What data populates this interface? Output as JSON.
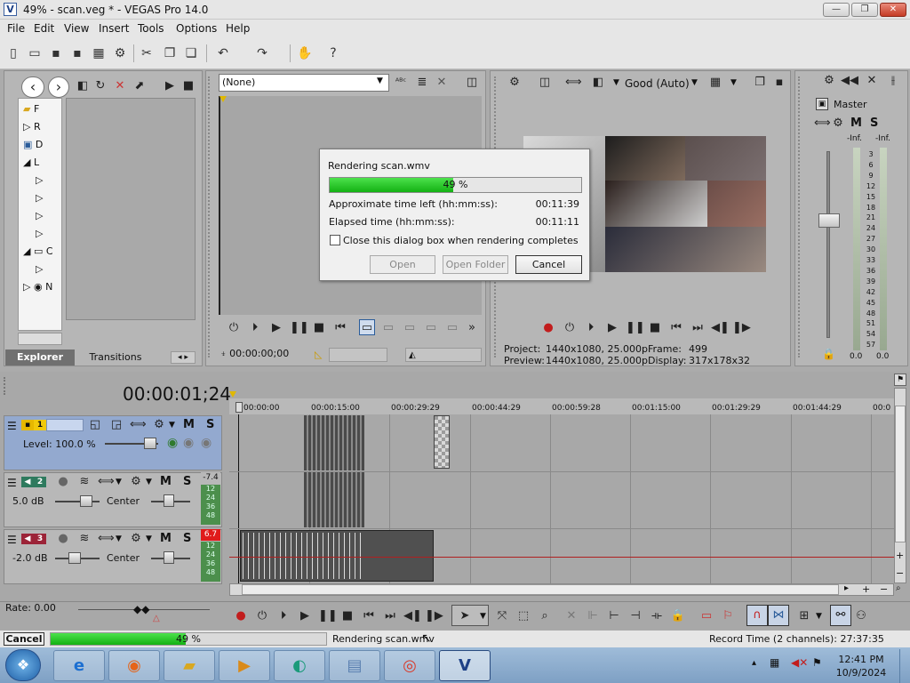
{
  "window": {
    "title": "49% - scan.veg * - VEGAS Pro 14.0",
    "app_icon": "V",
    "minimize": "—",
    "maximize": "❐",
    "close": "✕"
  },
  "menu": [
    "File",
    "Edit",
    "View",
    "Insert",
    "Tools",
    "Options",
    "Help"
  ],
  "explorer": {
    "tree": [
      "F",
      "R",
      "D",
      "L",
      "",
      "",
      "",
      "",
      "C",
      "",
      "N"
    ],
    "tabs": {
      "explorer": "Explorer",
      "transitions": "Transitions"
    }
  },
  "trimmer": {
    "select_value": "(None)",
    "timecode": "00:00:00;00"
  },
  "preview": {
    "quality": "Good (Auto)",
    "project_label": "Project:",
    "project_value": "1440x1080, 25.000p",
    "preview_label": "Preview:",
    "preview_value": "1440x1080, 25.000p",
    "frame_label": "Frame:",
    "frame_value": "499",
    "display_label": "Display:",
    "display_value": "317x178x32"
  },
  "mixer": {
    "master_label": "Master",
    "m": "M",
    "s": "S",
    "left_db": "-Inf.",
    "right_db": "-Inf.",
    "scale": [
      "3",
      "6",
      "9",
      "12",
      "15",
      "18",
      "21",
      "24",
      "27",
      "30",
      "33",
      "36",
      "39",
      "42",
      "45",
      "48",
      "51",
      "54",
      "57"
    ],
    "bottom_left": "0.0",
    "bottom_right": "0.0"
  },
  "dialog": {
    "title": "Rendering scan.wmv",
    "progress": 49,
    "progress_label": "49 %",
    "time_left_label": "Approximate time left (hh:mm:ss):",
    "time_left_value": "00:11:39",
    "elapsed_label": "Elapsed time (hh:mm:ss):",
    "elapsed_value": "00:11:11",
    "close_when_done_label": "Close this dialog box when rendering completes",
    "open_button": "Open",
    "open_folder_button": "Open Folder",
    "cancel_button": "Cancel"
  },
  "timeline": {
    "timecode": "00:00:01;24",
    "ruler": [
      "00:00:00",
      "00:00:15:00",
      "00:00:29:29",
      "00:00:44:29",
      "00:00:59:28",
      "00:01:15:00",
      "00:01:29:29",
      "00:01:44:29",
      "00:0"
    ],
    "tracks": [
      {
        "num": "1",
        "label": "Level: 100.0 %",
        "m": "M",
        "s": "S",
        "color": "#d9b40c"
      },
      {
        "num": "2",
        "vol": "5.0 dB",
        "pan": "Center",
        "m": "M",
        "s": "S",
        "color": "#2e7a5e",
        "meter_peak": "-7.4",
        "meter": [
          "12",
          "24",
          "36",
          "48"
        ]
      },
      {
        "num": "3",
        "vol": "-2.0 dB",
        "pan": "Center",
        "m": "M",
        "s": "S",
        "color": "#9c2438",
        "meter_peak": "6.7",
        "meter": [
          "12",
          "24",
          "36",
          "48"
        ]
      }
    ],
    "rate": "Rate: 0.00"
  },
  "status": {
    "cancel": "Cancel",
    "progress": 49,
    "progress_label": "49 %",
    "rendering": "Rendering scan.wmv",
    "record_time": "Record Time (2 channels): 27:37:35"
  },
  "taskbar": {
    "time": "12:41 PM",
    "date": "10/9/2024"
  }
}
